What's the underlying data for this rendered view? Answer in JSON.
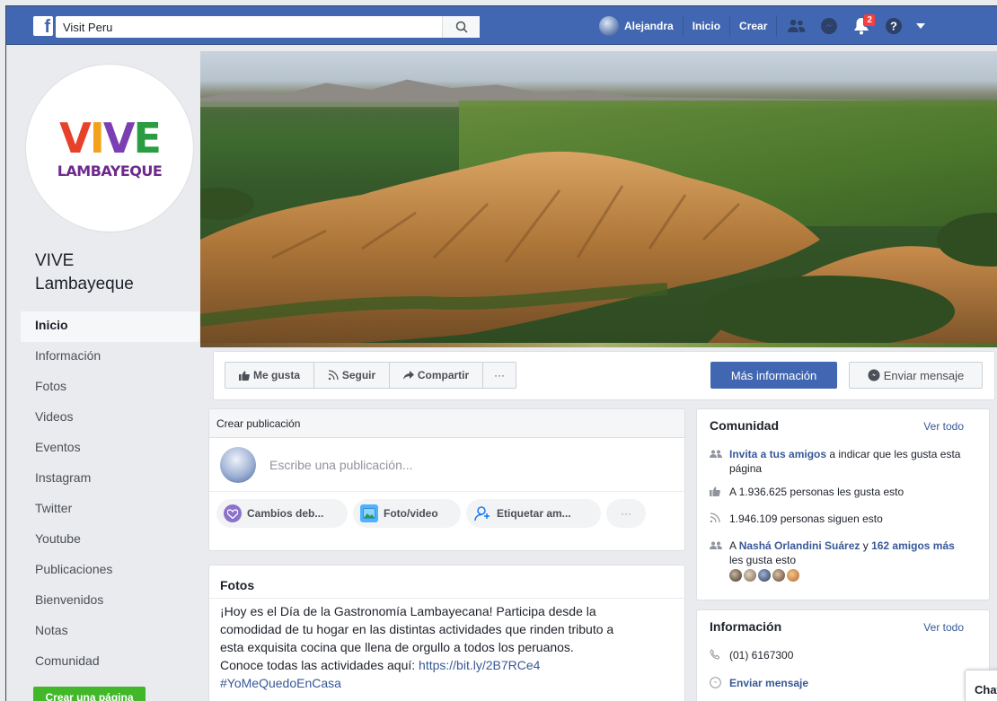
{
  "topbar": {
    "search_value": "Visit Peru",
    "user_name": "Alejandra",
    "nav_home": "Inicio",
    "nav_create": "Crear",
    "notifications_count": "2"
  },
  "page": {
    "logo_word": [
      "V",
      "I",
      "V",
      "E"
    ],
    "logo_sub": "LAMBAYEQUE",
    "name_line1": "VIVE",
    "name_line2": "Lambayeque"
  },
  "sidebar": {
    "items": [
      {
        "label": "Inicio",
        "active": true
      },
      {
        "label": "Información"
      },
      {
        "label": "Fotos"
      },
      {
        "label": "Videos"
      },
      {
        "label": "Eventos"
      },
      {
        "label": "Instagram"
      },
      {
        "label": "Twitter"
      },
      {
        "label": "Youtube"
      },
      {
        "label": "Publicaciones"
      },
      {
        "label": "Bienvenidos"
      },
      {
        "label": "Notas"
      },
      {
        "label": "Comunidad"
      }
    ],
    "create_page": "Crear una página"
  },
  "actions": {
    "like": "Me gusta",
    "follow": "Seguir",
    "share": "Compartir",
    "more": "···",
    "more_info": "Más información",
    "send_message": "Enviar mensaje"
  },
  "composer": {
    "title": "Crear publicación",
    "placeholder": "Escribe una publicación...",
    "chips": [
      "Cambios deb...",
      "Foto/video",
      "Etiquetar am...",
      "···"
    ]
  },
  "photos_post": {
    "title": "Fotos",
    "text_lines": [
      "¡Hoy es el Día de la Gastronomía Lambayecana! Participa desde la",
      "comodidad de tu hogar en las distintas actividades que rinden tributo a",
      "esta exquisita cocina que llena de orgullo a todos los peruanos."
    ],
    "link_prefix": "Conoce todas las actividades aquí: ",
    "link": "https://bit.ly/2B7RCe4",
    "hashtag": "#YoMeQuedoEnCasa"
  },
  "community": {
    "title": "Comunidad",
    "see_all": "Ver todo",
    "invite_bold": "Invita a tus amigos",
    "invite_rest": " a indicar que les gusta esta página",
    "likes": "A 1.936.625 personas les gusta esto",
    "followers": "1.946.109 personas siguen esto",
    "friends_prefix": "A ",
    "friend_name": "Nashá Orlandini Suárez",
    "friends_mid": " y ",
    "friends_more": "162 amigos más",
    "friends_suffix": " les gusta esto"
  },
  "info": {
    "title": "Información",
    "see_all": "Ver todo",
    "phone": "(01) 6167300",
    "send_message": "Enviar mensaje"
  },
  "chat_label": "Chat"
}
